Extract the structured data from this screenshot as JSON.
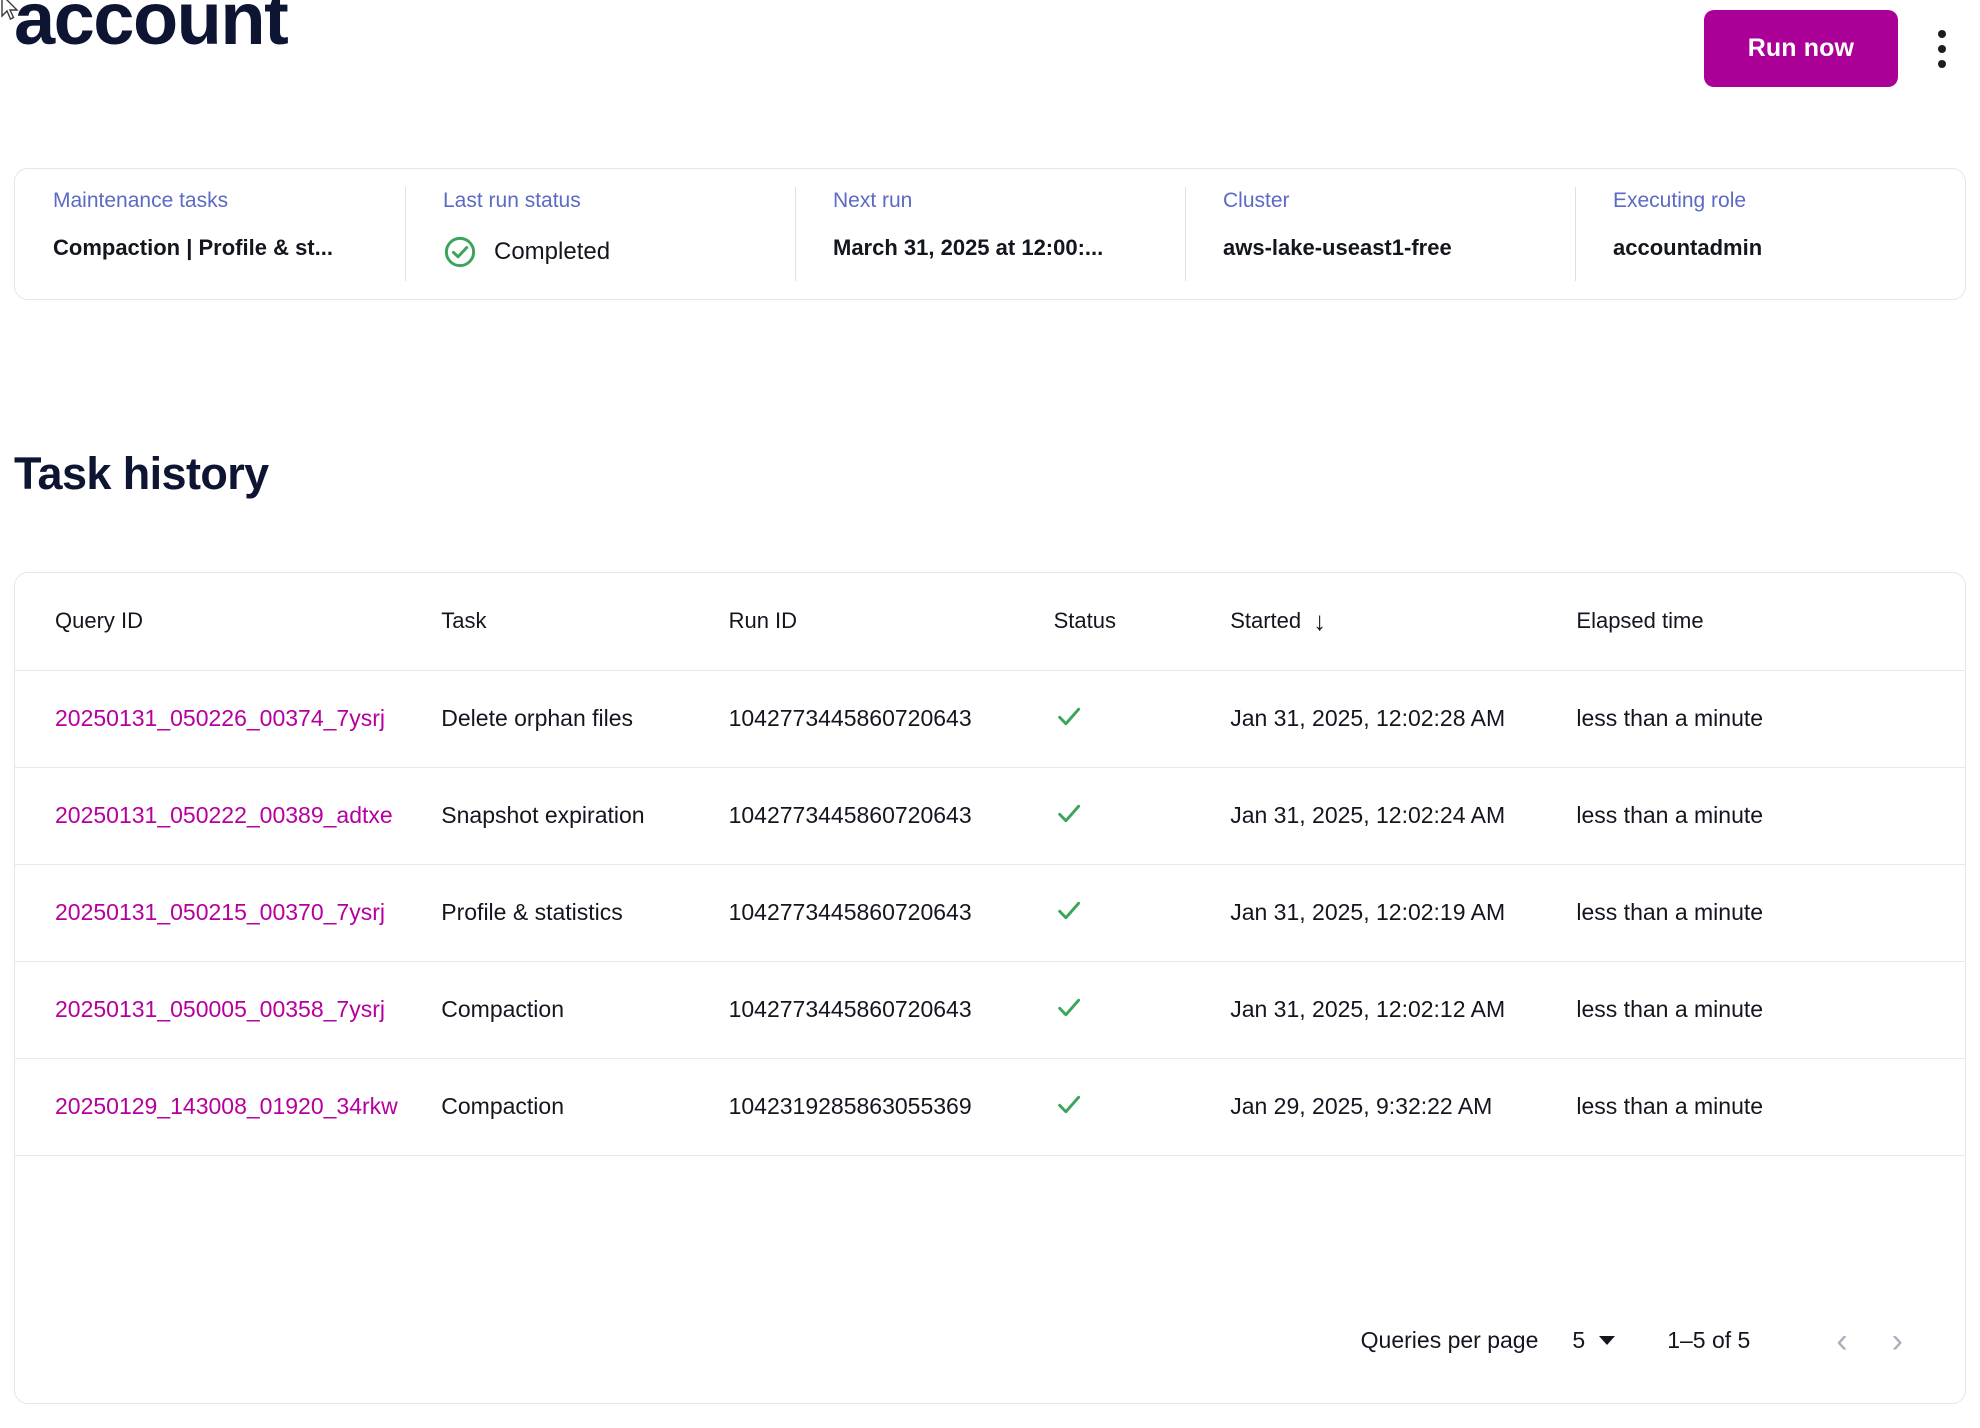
{
  "header": {
    "title": "account",
    "run_now_label": "Run now",
    "more_menu_icon": "kebab-menu-icon"
  },
  "summary": {
    "items": [
      {
        "label": "Maintenance tasks",
        "value": "Compaction | Profile & st..."
      },
      {
        "label": "Last run status",
        "value": "Completed",
        "icon": "check-circle-icon",
        "icon_color": "#3BA55C"
      },
      {
        "label": "Next run",
        "value": "March 31, 2025 at 12:00:..."
      },
      {
        "label": "Cluster",
        "value": "aws-lake-useast1-free"
      },
      {
        "label": "Executing role",
        "value": "accountadmin"
      }
    ]
  },
  "section": {
    "title": "Task history"
  },
  "table": {
    "columns": [
      "Query ID",
      "Task",
      "Run ID",
      "Status",
      "Started",
      "Elapsed time"
    ],
    "sort_column": "Started",
    "sort_direction": "↓",
    "rows": [
      {
        "query_id": "20250131_050226_00374_7ysrj",
        "task": "Delete orphan files",
        "run_id": "1042773445860720643",
        "status": "success",
        "started": "Jan 31, 2025, 12:02:28 AM",
        "elapsed": "less than a minute"
      },
      {
        "query_id": "20250131_050222_00389_adtxe",
        "task": "Snapshot expiration",
        "run_id": "1042773445860720643",
        "status": "success",
        "started": "Jan 31, 2025, 12:02:24 AM",
        "elapsed": "less than a minute"
      },
      {
        "query_id": "20250131_050215_00370_7ysrj",
        "task": "Profile & statistics",
        "run_id": "1042773445860720643",
        "status": "success",
        "started": "Jan 31, 2025, 12:02:19 AM",
        "elapsed": "less than a minute"
      },
      {
        "query_id": "20250131_050005_00358_7ysrj",
        "task": "Compaction",
        "run_id": "1042773445860720643",
        "status": "success",
        "started": "Jan 31, 2025, 12:02:12 AM",
        "elapsed": "less than a minute"
      },
      {
        "query_id": "20250129_143008_01920_34rkw",
        "task": "Compaction",
        "run_id": "1042319285863055369",
        "status": "success",
        "started": "Jan 29, 2025, 9:32:22 AM",
        "elapsed": "less than a minute"
      }
    ]
  },
  "pagination": {
    "per_page_label": "Queries per page",
    "per_page_value": "5",
    "range_label": "1–5 of 5",
    "prev_icon": "chevron-left-icon",
    "next_icon": "chevron-right-icon"
  },
  "colors": {
    "accent": "#AB0097",
    "link": "#B5009F",
    "label": "#5B6AC4",
    "success": "#3BA55C",
    "title": "#0D1532",
    "border": "#E2E6F0"
  }
}
